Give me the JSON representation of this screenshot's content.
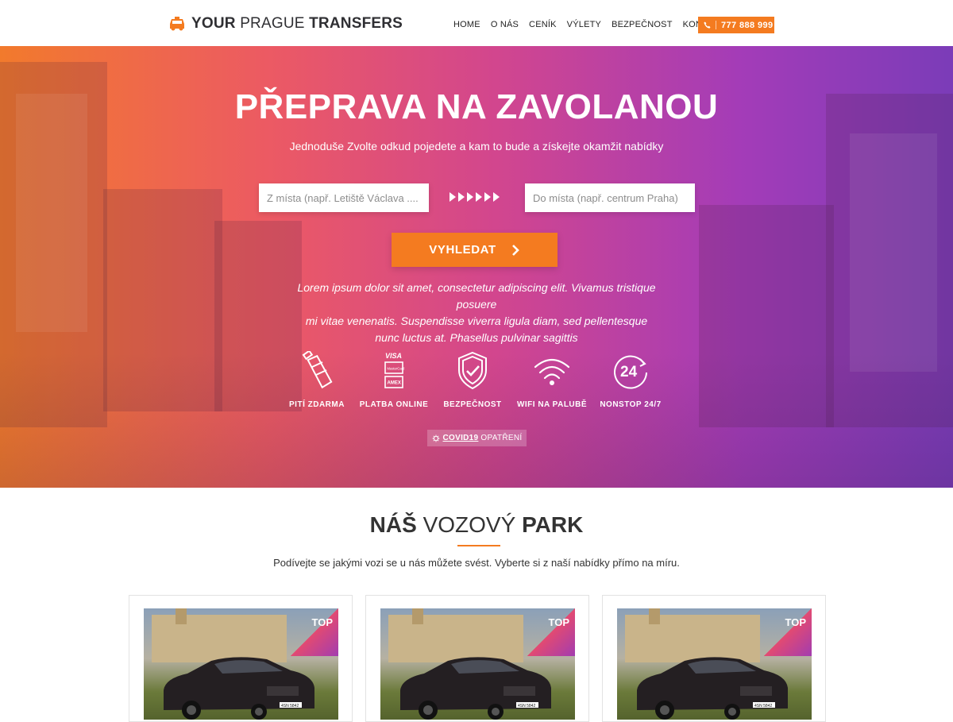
{
  "brand": {
    "part1": "YOUR",
    "part2": "PRAGUE",
    "part3": "TRANSFERS",
    "accent": "#f47b20"
  },
  "nav": [
    {
      "label": "HOME"
    },
    {
      "label": "O NÁS"
    },
    {
      "label": "CENÍK"
    },
    {
      "label": "VÝLETY"
    },
    {
      "label": "BEZPEČNOST"
    },
    {
      "label": "KONTAKT"
    }
  ],
  "phone": "777 888 999",
  "hero": {
    "title": "PŘEPRAVA NA ZAVOLANOU",
    "subtitle": "Jednoduše Zvolte odkud pojedete a kam to bude a získejte okamžit nabídky",
    "from_placeholder": "Z místa (např. Letiště Václava ....",
    "to_placeholder": "Do místa (např. centrum Praha)",
    "search_label": "VYHLEDAT",
    "lorem_lines": [
      "Lorem ipsum dolor sit amet, consectetur adipiscing elit. Vivamus tristique posuere",
      "mi vitae venenatis. Suspendisse viverra ligula diam, sed pellentesque",
      "nunc luctus at. Phasellus pulvinar sagittis"
    ],
    "features": [
      {
        "label": "PITÍ ZDARMA",
        "icon": "bottle-icon"
      },
      {
        "label": "PLATBA ONLINE",
        "icon": "credit-cards-icon"
      },
      {
        "label": "BEZPEČNOST",
        "icon": "shield-check-icon"
      },
      {
        "label": "WIFI NA PALUBĚ",
        "icon": "wifi-icon"
      },
      {
        "label": "NONSTOP 24/7",
        "icon": "clock-24-icon"
      }
    ],
    "covid_bold": "COVID19",
    "covid_rest": "OPATŘENÍ",
    "card_labels": {
      "visa": "VISA",
      "mastercard": "MasterCard",
      "amex": "AMEX"
    },
    "clock_label": "24"
  },
  "fleet": {
    "title_bold1": "NÁŠ",
    "title_light": "VOZOVÝ",
    "title_bold2": "PARK",
    "subtitle": "Podívejte se jakými vozi se u nás můžete svést. Vyberte si z naší nabídky přímo na míru.",
    "cards": [
      {
        "badge": "TOP",
        "plate": "4SN 5842"
      },
      {
        "badge": "TOP",
        "plate": "4SN 5842"
      },
      {
        "badge": "TOP",
        "plate": "4SN 5842"
      }
    ]
  }
}
